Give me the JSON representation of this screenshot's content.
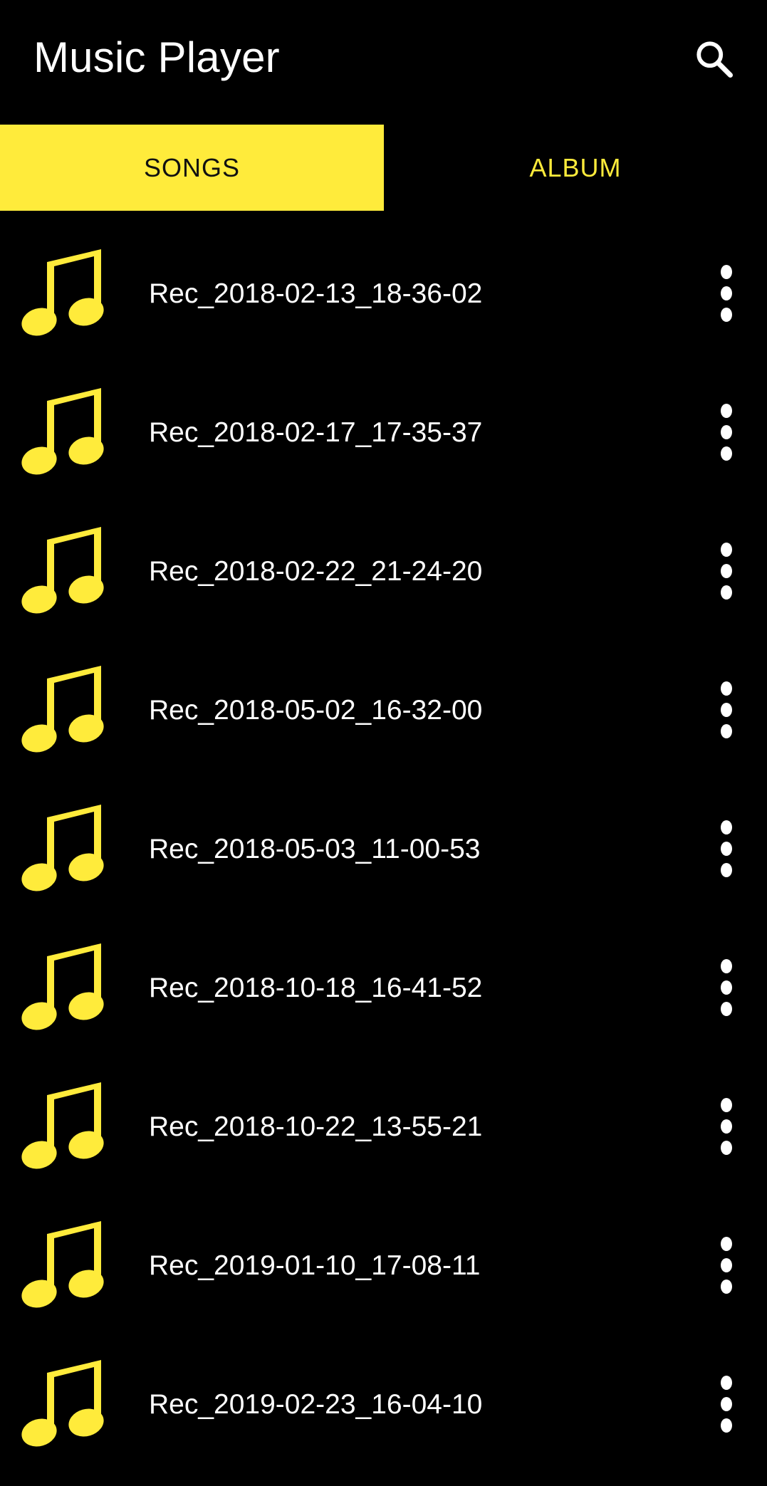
{
  "app_bar": {
    "title": "Music Player",
    "search_icon": "search-icon"
  },
  "tabs": [
    {
      "label": "SONGS",
      "selected": true
    },
    {
      "label": "ALBUM",
      "selected": false
    }
  ],
  "colors": {
    "accent": "#FFEB3B",
    "background": "#000000",
    "text": "#FFFFFF"
  },
  "songs": [
    {
      "title": "Rec_2018-02-13_18-36-02",
      "icon": "music-note-icon",
      "menu_icon": "more-vert-icon"
    },
    {
      "title": "Rec_2018-02-17_17-35-37",
      "icon": "music-note-icon",
      "menu_icon": "more-vert-icon"
    },
    {
      "title": "Rec_2018-02-22_21-24-20",
      "icon": "music-note-icon",
      "menu_icon": "more-vert-icon"
    },
    {
      "title": "Rec_2018-05-02_16-32-00",
      "icon": "music-note-icon",
      "menu_icon": "more-vert-icon"
    },
    {
      "title": "Rec_2018-05-03_11-00-53",
      "icon": "music-note-icon",
      "menu_icon": "more-vert-icon"
    },
    {
      "title": "Rec_2018-10-18_16-41-52",
      "icon": "music-note-icon",
      "menu_icon": "more-vert-icon"
    },
    {
      "title": "Rec_2018-10-22_13-55-21",
      "icon": "music-note-icon",
      "menu_icon": "more-vert-icon"
    },
    {
      "title": "Rec_2019-01-10_17-08-11",
      "icon": "music-note-icon",
      "menu_icon": "more-vert-icon"
    },
    {
      "title": "Rec_2019-02-23_16-04-10",
      "icon": "music-note-icon",
      "menu_icon": "more-vert-icon"
    }
  ]
}
